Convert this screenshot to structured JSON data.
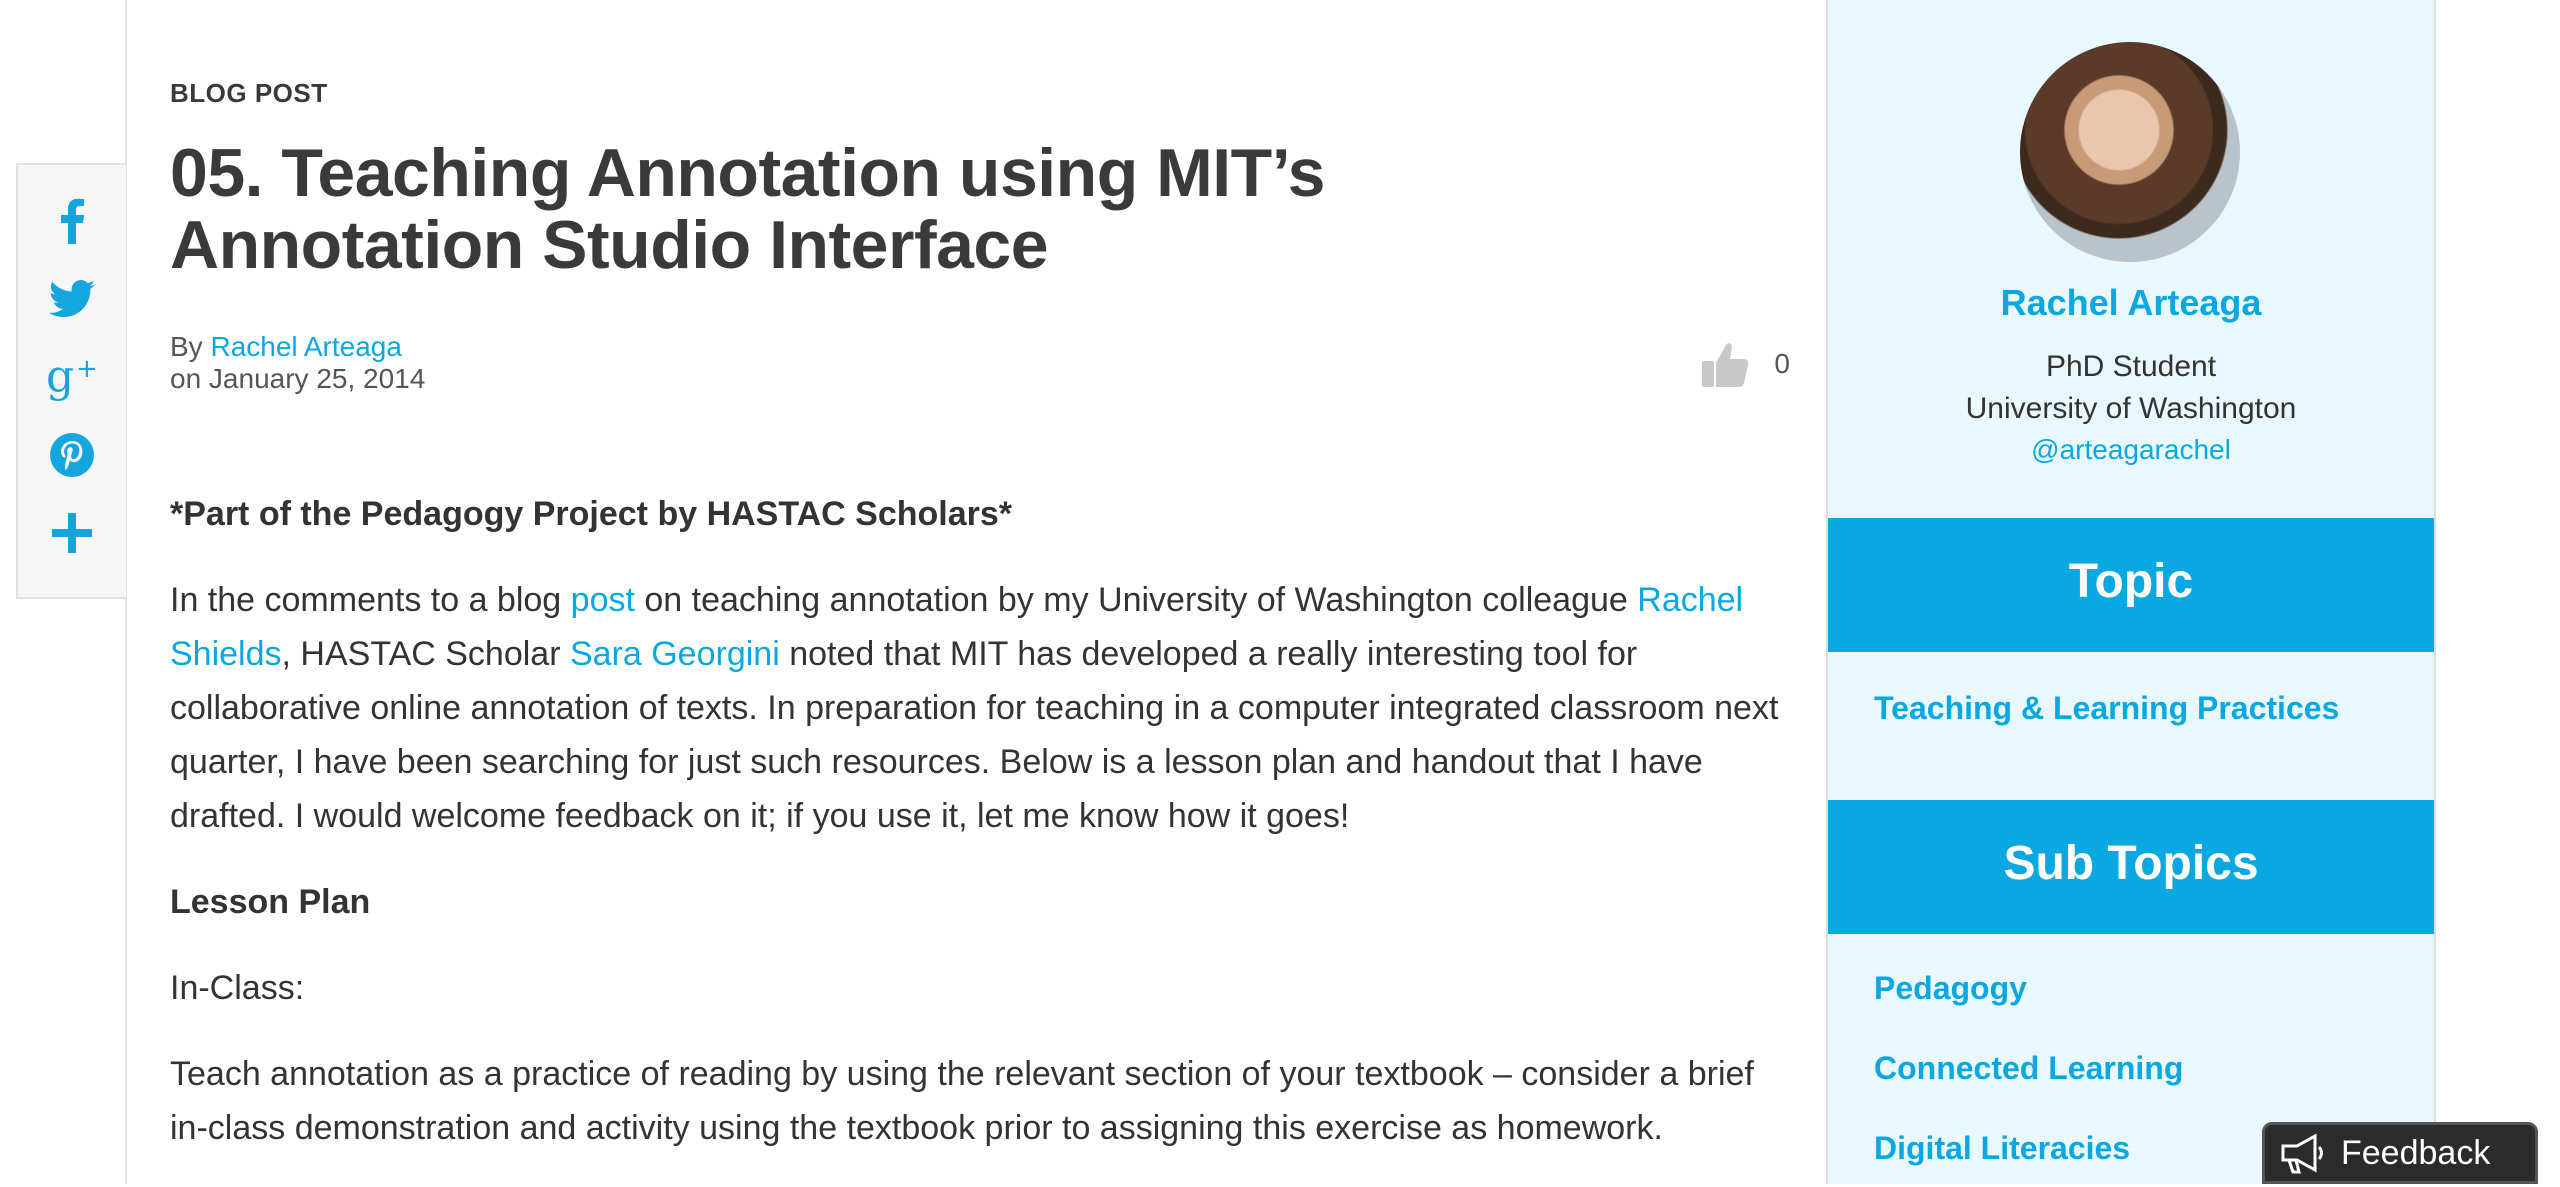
{
  "share": {
    "icons": [
      "facebook-icon",
      "twitter-icon",
      "google-plus-icon",
      "pinterest-icon",
      "plus-icon"
    ]
  },
  "article": {
    "post_type": "BLOG POST",
    "title": "05. Teaching Annotation using MIT’s Annotation Studio Interface",
    "by_prefix": "By ",
    "author": "Rachel Arteaga",
    "date": "on January 25, 2014",
    "likes": "0",
    "intro": "*Part of the Pedagogy Project by HASTAC Scholars*",
    "p1": {
      "t1": "In the comments to a blog ",
      "l1": "post",
      "t2": " on teaching annotation by my University of Washington colleague ",
      "l2": "Rachel Shields",
      "t3": ", HASTAC Scholar ",
      "l3": "Sara Georgini",
      "t4": " noted that MIT has developed a really interesting tool for collaborative online annotation of texts. In preparation for teaching in a computer integrated classroom next quarter, I have been searching for just such resources. Below is a lesson plan and handout that I have drafted. I would welcome feedback on it; if you use it, let me know how it goes!"
    },
    "lesson_plan_heading": "Lesson Plan",
    "in_class": "In-Class:",
    "p2": "Teach annotation as a practice of reading by using the relevant section of your textbook – consider a brief in-class demonstration and activity using the textbook prior to assigning this exercise as homework."
  },
  "sidebar": {
    "name": "Rachel Arteaga",
    "role": "PhD Student",
    "org": "University of Washington",
    "handle": "@arteagarachel",
    "topic_heading": "Topic",
    "topic_link": "Teaching & Learning Practices",
    "subtopics_heading": "Sub Topics",
    "subtopics": [
      "Pedagogy",
      "Connected Learning",
      "Digital Literacies"
    ]
  },
  "feedback": {
    "label": "Feedback"
  },
  "colors": {
    "accent": "#0aa8e0",
    "sidebar_bg": "#e8f8fd",
    "text": "#3a3a3a"
  }
}
